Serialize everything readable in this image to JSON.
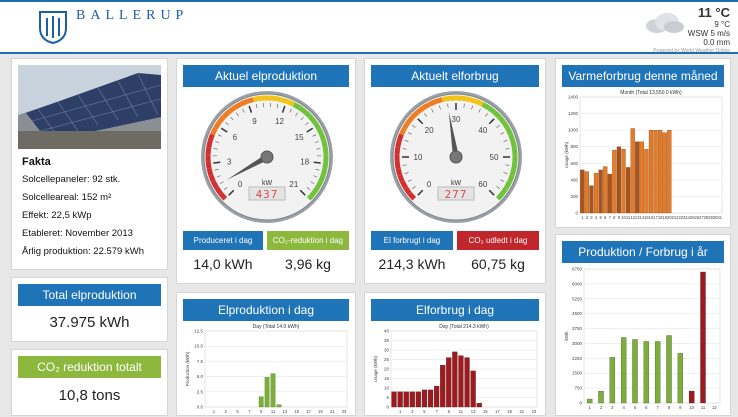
{
  "header": {
    "brand": "BALLERUP",
    "weather": {
      "temp": "11 °C",
      "feels": "9 °C",
      "wind": "WSW 5 m/s",
      "rain": "0.0 mm",
      "credit": "Powered by World Weather Online"
    }
  },
  "colors": {
    "blue": "#1f74b8",
    "green": "#8cb83e",
    "red": "#c0262c",
    "orange_bar": "#e47b27",
    "dark_orange_bar": "#a9541c",
    "dark_red_bar": "#9b1b1f",
    "green_bar": "#7dae3a"
  },
  "facts": {
    "title": "Fakta",
    "rows": [
      "Solcellepaneler: 92 stk.",
      "Solcelleareal: 152 m²",
      "Effekt: 22,5 kWp",
      "Etableret: November 2013",
      "Årlig produktion: 22.579 kWh"
    ]
  },
  "total_production": {
    "title": "Total elproduktion",
    "value": "37.975 kWh"
  },
  "co2_total": {
    "title": "CO₂ reduktion totalt",
    "value": "10,8 tons"
  },
  "gauge_production": {
    "title": "Aktuel elproduktion",
    "ticks": [
      "0",
      "3",
      "6",
      "9",
      "12",
      "15",
      "18",
      "21"
    ],
    "unit": "kW",
    "display": "437",
    "needle_value": 1.2,
    "max": 21
  },
  "gauge_consumption": {
    "title": "Aktuelt elforbrug",
    "ticks": [
      "0",
      "10",
      "20",
      "30",
      "40",
      "50",
      "60"
    ],
    "unit": "kW",
    "display": "277",
    "needle_value": 28,
    "max": 60
  },
  "stats": {
    "produced_label": "Produceret i dag",
    "produced_value": "14,0 kWh",
    "co2_label": "CO₂-reduktion i dag",
    "co2_value": "3,96 kg",
    "consumption_label": "El forbrugt i dag",
    "consumption_value": "214,3 kWh",
    "emitted_label": "CO₂ udledt i dag",
    "emitted_value": "60,75 kg"
  },
  "panels": {
    "heat_title": "Varmeforbrug denne måned",
    "prod_day_title": "Elproduktion i dag",
    "cons_day_title": "Elforbrug i dag",
    "year_title": "Produktion / Forbrug i år"
  },
  "chart_data": [
    {
      "type": "bar",
      "title": "Month (Total 13,550.0 kWh)",
      "ylabel": "Usage (kWh)",
      "ylim": [
        0,
        1400
      ],
      "yticks": [
        "0",
        "200",
        "400",
        "600",
        "800",
        "1000",
        "1200",
        "1400"
      ],
      "categories": [
        "1",
        "2",
        "3",
        "4",
        "5",
        "6",
        "7",
        "8",
        "9",
        "10",
        "11",
        "12",
        "13",
        "14",
        "15",
        "16",
        "17",
        "18",
        "19",
        "20",
        "21",
        "22",
        "23",
        "24",
        "25",
        "26",
        "27",
        "28",
        "29",
        "30",
        "31"
      ],
      "values": [
        520,
        500,
        330,
        480,
        520,
        560,
        470,
        760,
        800,
        770,
        550,
        1020,
        860,
        860,
        770,
        1000,
        1000,
        1000,
        970,
        1000,
        0,
        0,
        0,
        0,
        0,
        0,
        0,
        0,
        0,
        0,
        0
      ]
    },
    {
      "type": "bar",
      "title": "Day (Total 14.0 kWh)",
      "ylabel": "Production (kWh)",
      "ylim": [
        0,
        12.5
      ],
      "yticks": [
        "0.0",
        "2.5",
        "5.0",
        "7.5",
        "10.0",
        "12.5"
      ],
      "categories": [
        "0",
        "1",
        "2",
        "3",
        "4",
        "5",
        "6",
        "7",
        "8",
        "9",
        "10",
        "11",
        "12",
        "13",
        "14",
        "15",
        "16",
        "17",
        "18",
        "19",
        "20",
        "21",
        "22",
        "23"
      ],
      "xlabels": [
        "1",
        "3",
        "5",
        "7",
        "9",
        "11",
        "13",
        "15",
        "17",
        "19",
        "21",
        "23"
      ],
      "values": [
        0,
        0,
        0,
        0,
        0,
        0,
        0,
        0,
        0,
        1.7,
        4.9,
        5.5,
        0.4,
        0,
        0,
        0,
        0,
        0,
        0,
        0,
        0,
        0,
        0,
        0
      ]
    },
    {
      "type": "bar",
      "title": "Day (Total 214.3 kWh)",
      "ylabel": "Usage (kWh)",
      "ylim": [
        0,
        40
      ],
      "yticks": [
        "0",
        "5",
        "10",
        "15",
        "20",
        "25",
        "30",
        "35",
        "40"
      ],
      "categories": [
        "0",
        "1",
        "2",
        "3",
        "4",
        "5",
        "6",
        "7",
        "8",
        "9",
        "10",
        "11",
        "12",
        "13",
        "14",
        "15",
        "16",
        "17",
        "18",
        "19",
        "20",
        "21",
        "22",
        "23"
      ],
      "xlabels": [
        "1",
        "3",
        "5",
        "7",
        "9",
        "11",
        "13",
        "15",
        "17",
        "19",
        "21",
        "23"
      ],
      "values": [
        8,
        8,
        8,
        8,
        8,
        9,
        9,
        11,
        22,
        26,
        29,
        27,
        26,
        19,
        2,
        0,
        0,
        0,
        0,
        0,
        0,
        0,
        0,
        0
      ]
    },
    {
      "type": "bar",
      "ylabel": "kWh",
      "ylim": [
        0,
        6750
      ],
      "yticks": [
        "0",
        "750",
        "1500",
        "2250",
        "3000",
        "3750",
        "4500",
        "5250",
        "6000",
        "6750"
      ],
      "categories": [
        "1",
        "2",
        "3",
        "4",
        "5",
        "6",
        "7",
        "8",
        "9",
        "10",
        "11",
        "12"
      ],
      "xlabels": [
        "1",
        "2",
        "3",
        "4",
        "5",
        "6",
        "7",
        "8",
        "9",
        "10",
        "11",
        "12"
      ],
      "series": [
        {
          "values": [
            200,
            600,
            2300,
            3300,
            3200,
            3100,
            3100,
            3400,
            2500,
            600,
            0,
            0
          ]
        },
        {
          "values": [
            0,
            0,
            0,
            0,
            0,
            0,
            0,
            0,
            0,
            600,
            6600,
            0
          ]
        }
      ]
    }
  ]
}
